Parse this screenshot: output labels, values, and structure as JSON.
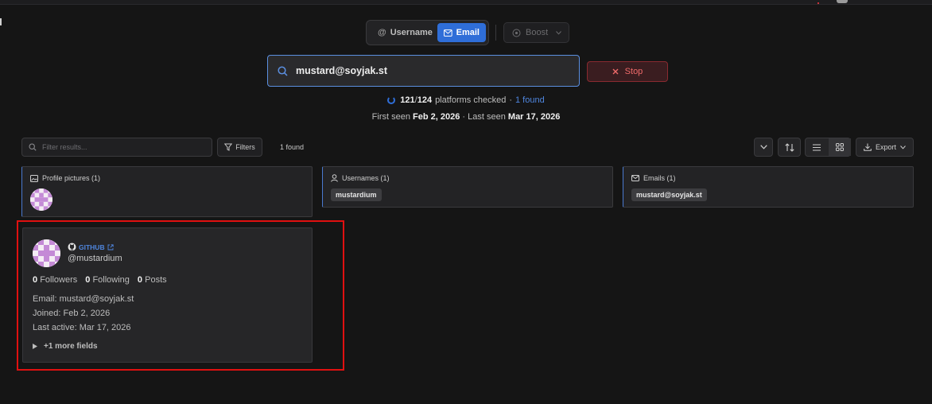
{
  "colors": {
    "accent": "#2f6ed8",
    "stop": "#f06a6a",
    "highlight": "#e01010",
    "background": "#151515"
  },
  "mode": {
    "username_label": "Username",
    "email_label": "Email",
    "active": "Email"
  },
  "boost": {
    "label": "Boost"
  },
  "search": {
    "value": "mustard@soyjak.st"
  },
  "stop": {
    "label": "Stop"
  },
  "status": {
    "checked": "121",
    "total": "124",
    "suffix": "platforms checked",
    "separator": "·",
    "found": "1 found"
  },
  "dates": {
    "first_label": "First seen",
    "first_value": "Feb 2, 2026",
    "separator": "·",
    "last_label": "Last seen",
    "last_value": "Mar 17, 2026"
  },
  "toolbar": {
    "filter_placeholder": "Filter results...",
    "filters_label": "Filters",
    "count": "1 found",
    "export_label": "Export"
  },
  "summary": [
    {
      "title": "Profile pictures (1)",
      "icon": "image-icon"
    },
    {
      "title": "Usernames (1)",
      "icon": "user-icon",
      "chip": "mustardium"
    },
    {
      "title": "Emails (1)",
      "icon": "mail-icon",
      "chip": "mustard@soyjak.st"
    }
  ],
  "result": {
    "platform": "GITHUB",
    "handle": "@mustardium",
    "followers_value": "0",
    "followers_label": "Followers",
    "following_value": "0",
    "following_label": "Following",
    "posts_value": "0",
    "posts_label": "Posts",
    "email_line": "Email: mustard@soyjak.st",
    "joined_label": "Joined:",
    "joined_value": "Feb 2, 2026",
    "last_active_line": "Last active: Mar 17, 2026",
    "more_fields": "+1 more fields"
  }
}
